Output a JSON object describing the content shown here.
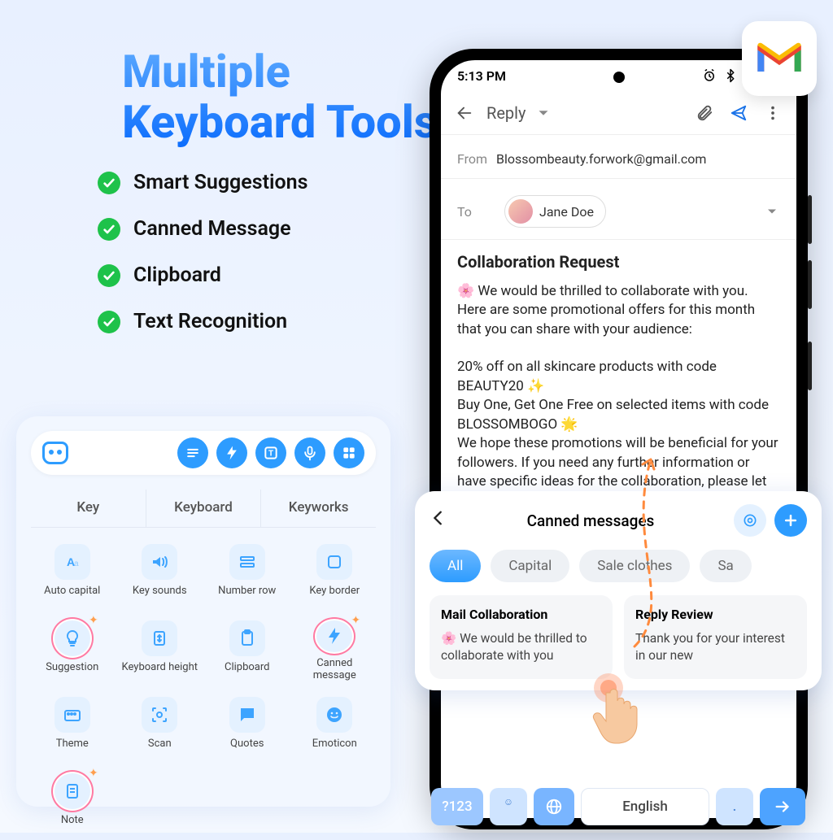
{
  "headline": {
    "line1": "Multiple",
    "line2": "Keyboard Tools"
  },
  "features": [
    "Smart Suggestions",
    "Canned Message",
    "Clipboard",
    "Text Recognition"
  ],
  "settings": {
    "tabs": [
      "Key",
      "Keyboard",
      "Keyworks"
    ],
    "items": [
      {
        "label": "Auto capital"
      },
      {
        "label": "Key sounds"
      },
      {
        "label": "Number row"
      },
      {
        "label": "Key border"
      },
      {
        "label": "Suggestion",
        "ringed": true
      },
      {
        "label": "Keyboard height"
      },
      {
        "label": "Clipboard"
      },
      {
        "label": "Canned message",
        "ringed": true
      },
      {
        "label": "Theme"
      },
      {
        "label": "Scan"
      },
      {
        "label": "Quotes"
      },
      {
        "label": "Emoticon"
      },
      {
        "label": "Note",
        "ringed": true
      }
    ]
  },
  "phone": {
    "time": "5:13 PM",
    "topbar": {
      "title": "Reply"
    },
    "from_label": "From",
    "from_value": "Blossombeauty.forwork@gmail.com",
    "to_label": "To",
    "to_name": "Jane Doe",
    "subject": "Collaboration Request",
    "body": "🌸 We would be thrilled to collaborate with you. Here are some promotional offers for this month that you can share with your audience:\n\n20% off on all skincare products with code BEAUTY20 ✨\nBuy One, Get One Free on selected items with code BLOSSOMBOGO 🌟\nWe hope these promotions will be beneficial for your followers. If you need any further information or have specific ideas for the collaboration, please let us know."
  },
  "canned": {
    "title": "Canned messages",
    "filters": [
      "All",
      "Capital",
      "Sale clothes",
      "Sa"
    ],
    "cards": [
      {
        "title": "Mail Collaboration",
        "body": "🌸 We would be thrilled to collaborate with you"
      },
      {
        "title": "Reply Review",
        "body": "Thank you for your interest in our new"
      }
    ]
  },
  "keyboard": {
    "sym": "?123",
    "comma": ",",
    "space": "English",
    "dot": ".",
    "emoji": "☺"
  }
}
